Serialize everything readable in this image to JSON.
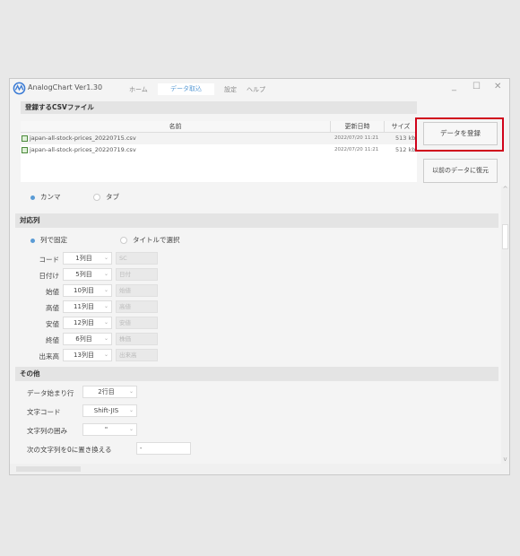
{
  "app": {
    "title": "AnalogChart Ver1.30"
  },
  "tabs": [
    {
      "label": "ホーム"
    },
    {
      "label": "データ取込"
    },
    {
      "label": "設定"
    },
    {
      "label": "ヘルプ"
    }
  ],
  "active_tab": "データ取込",
  "window_controls": {
    "minimize": "_",
    "maximize": "☐",
    "close": "✕"
  },
  "files_section": {
    "title": "登録するCSVファイル",
    "columns": [
      "名前",
      "更新日時",
      "サイズ"
    ],
    "rows": [
      {
        "name": "japan-all-stock-prices_20220715.csv",
        "date": "2022/07/20 11:21",
        "size": "513 kb"
      },
      {
        "name": "japan-all-stock-prices_20220719.csv",
        "date": "2022/07/20 11:21",
        "size": "512 kb"
      }
    ]
  },
  "buttons": {
    "register": "データを登録",
    "restore": "以前のデータに復元"
  },
  "delimiter": {
    "comma": "カンマ",
    "tab": "タブ",
    "selected": "カンマ"
  },
  "columns_section": {
    "title": "対応列",
    "mode_fixed": "列で固定",
    "mode_title": "タイトルで選択",
    "selected": "列で固定",
    "rows": [
      {
        "label": "コード",
        "value": "1列目",
        "title": "SC"
      },
      {
        "label": "日付け",
        "value": "5列目",
        "title": "日付"
      },
      {
        "label": "始値",
        "value": "10列目",
        "title": "始値"
      },
      {
        "label": "高値",
        "value": "11列目",
        "title": "高値"
      },
      {
        "label": "安値",
        "value": "12列目",
        "title": "安値"
      },
      {
        "label": "終値",
        "value": "6列目",
        "title": "株価"
      },
      {
        "label": "出来高",
        "value": "13列目",
        "title": "出来高"
      }
    ]
  },
  "other_section": {
    "title": "その他",
    "start_row_label": "データ始まり行",
    "start_row_value": "2行目",
    "encoding_label": "文字コード",
    "encoding_value": "Shift-JIS",
    "quote_label": "文字列の囲み",
    "quote_value": "\"",
    "replace_label": "次の文字列を0に置き換える",
    "replace_value": "-"
  },
  "colors": {
    "accent": "#5a9bd5",
    "highlight": "#d0021b"
  }
}
